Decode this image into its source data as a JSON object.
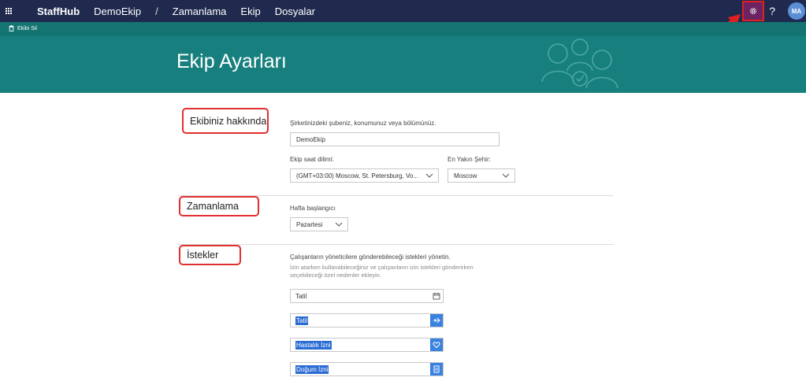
{
  "topbar": {
    "brand": "StaffHub",
    "team": "DemoEkip",
    "separator": "/",
    "nav": [
      "Zamanlama",
      "Ekip",
      "Dosyalar"
    ],
    "help": "?",
    "avatar_initials": "MA"
  },
  "header": {
    "delete_team": "Ekibi Sil",
    "title": "Ekip Ayarları"
  },
  "about": {
    "section_label": "Ekibiniz hakkında",
    "description": "Şirketinizdeki şubeniz, konumunuz veya bölümünüz.",
    "team_name_value": "DemoEkip",
    "timezone_label": "Ekip saat dilimi:",
    "timezone_value": "(GMT+03:00) Moscow, St. Petersburg, Vo...",
    "city_label": "En Yakın Şehir:",
    "city_value": "Moscow"
  },
  "scheduling": {
    "section_label": "Zamanlama",
    "week_start_label": "Hafta başlangıcı",
    "week_start_value": "Pazartesi"
  },
  "requests": {
    "section_label": "İstekler",
    "description": "Çalışanların yöneticilere gönderebileceği istekleri yönetin.",
    "sub_description": "İzin atarken kullanabileceğiniz ve çalışanların izin istekleri gönderirken seçebileceği özel nedenler ekleyin.",
    "reasons": [
      {
        "label": "Tatil",
        "selected": false,
        "icon": "calendar-icon"
      },
      {
        "label": "Tatil",
        "selected": true,
        "icon": "plane-icon"
      },
      {
        "label": "Hastalık İzni",
        "selected": true,
        "icon": "heart-icon"
      },
      {
        "label": "Doğum İzni",
        "selected": true,
        "icon": "document-icon"
      }
    ]
  },
  "colors": {
    "topbar": "#1f2a4e",
    "teal": "#17807e",
    "highlight": "#e02020",
    "selection": "#2b6cd4"
  }
}
